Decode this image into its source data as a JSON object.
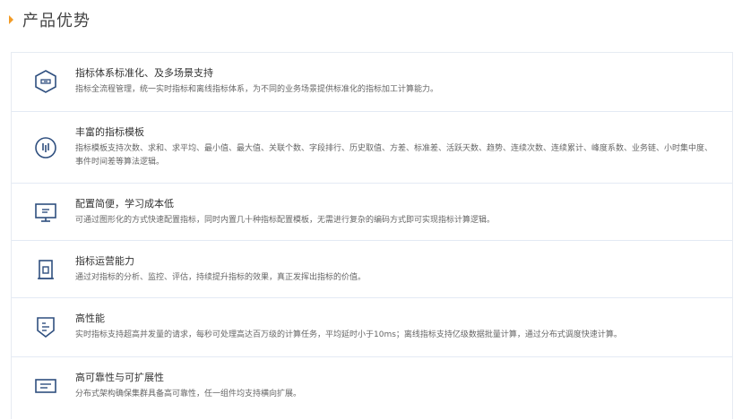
{
  "header": {
    "title": "产品优势"
  },
  "features": [
    {
      "icon": "layers-hexagon-icon",
      "title": "指标体系标准化、及多场景支持",
      "desc": "指标全流程管理，统一实时指标和离线指标体系，为不同的业务场景提供标准化的指标加工计算能力。"
    },
    {
      "icon": "template-circle-icon",
      "title": "丰富的指标模板",
      "desc": "指标模板支持次数、求和、求平均、最小值、最大值、关联个数、字段排行、历史取值、方差、标准差、活跃天数、趋势、连续次数、连续累计、峰度系数、业务链、小时集中度、事件时间差等算法逻辑。"
    },
    {
      "icon": "monitor-icon",
      "title": "配置简便，学习成本低",
      "desc": "可通过图形化的方式快速配置指标，同时内置几十种指标配置模板，无需进行复杂的编码方式即可实现指标计算逻辑。"
    },
    {
      "icon": "operation-frame-icon",
      "title": "指标运营能力",
      "desc": "通过对指标的分析、监控、评估，持续提升指标的效果，真正发挥出指标的价值。"
    },
    {
      "icon": "performance-shield-icon",
      "title": "高性能",
      "desc": "实时指标支持超高并发量的请求，每秒可处理高达百万级的计算任务，平均延时小于10ms；离线指标支持亿级数据批量计算，通过分布式调度快速计算。"
    },
    {
      "icon": "server-box-icon",
      "title": "高可靠性与可扩展性",
      "desc": "分布式架构确保集群具备高可靠性，任一组件均支持横向扩展。"
    }
  ],
  "colors": {
    "accent": "#f29b26",
    "icon": "#2f4f7f",
    "border": "#e3eaf4"
  }
}
